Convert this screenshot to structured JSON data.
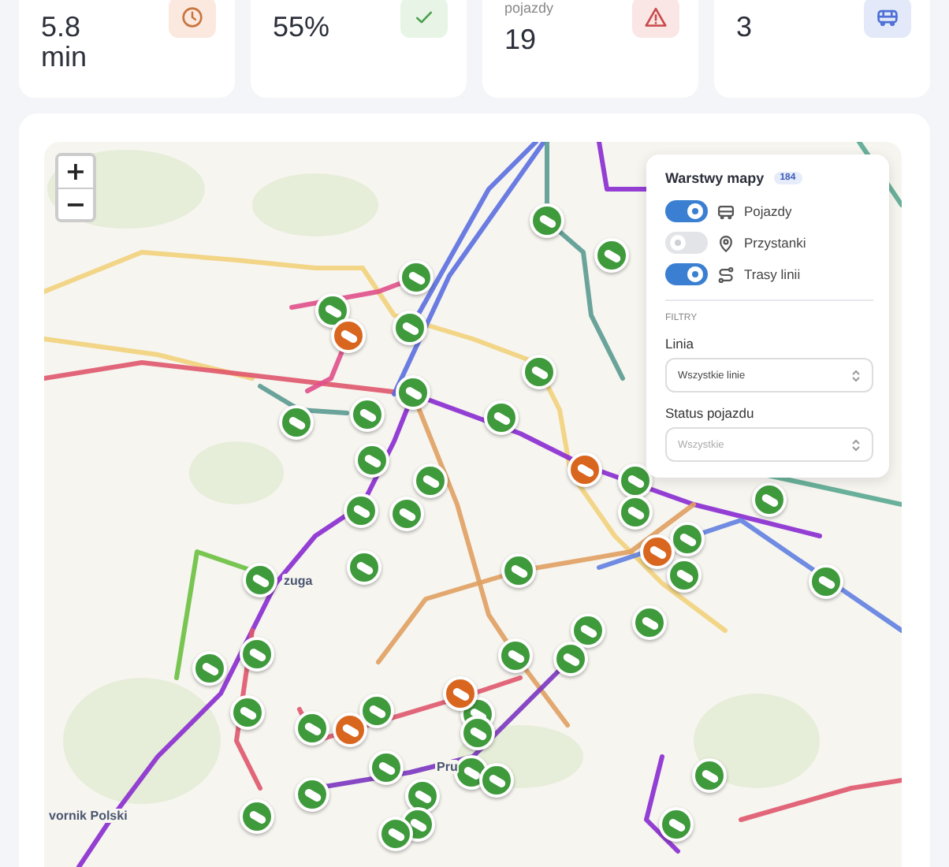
{
  "stats": [
    {
      "value": "5.8 min",
      "kind": "clock"
    },
    {
      "value": "55%",
      "kind": "check"
    },
    {
      "label": "pojazdy",
      "value": "19",
      "kind": "warning"
    },
    {
      "value": "3",
      "kind": "bus"
    }
  ],
  "map": {
    "zoom_in": "+",
    "zoom_out": "−",
    "labels": [
      "zuga",
      "vornik Polski",
      "Pru"
    ],
    "vehicles": [
      {
        "delayed": false
      },
      {
        "delayed": false
      },
      {
        "delayed": false
      },
      {
        "delayed": false
      },
      {
        "delayed": false
      },
      {
        "delayed": false
      },
      {
        "delayed": false
      },
      {
        "delayed": false
      },
      {
        "delayed": false
      },
      {
        "delayed": false
      },
      {
        "delayed": false
      },
      {
        "delayed": false
      },
      {
        "delayed": false
      },
      {
        "delayed": false
      },
      {
        "delayed": false
      },
      {
        "delayed": false
      },
      {
        "delayed": false
      },
      {
        "delayed": false
      },
      {
        "delayed": false
      },
      {
        "delayed": false
      },
      {
        "delayed": false
      },
      {
        "delayed": false
      },
      {
        "delayed": false
      },
      {
        "delayed": false
      },
      {
        "delayed": false
      },
      {
        "delayed": false
      },
      {
        "delayed": false
      },
      {
        "delayed": false
      },
      {
        "delayed": false
      },
      {
        "delayed": false
      },
      {
        "delayed": false
      },
      {
        "delayed": false
      },
      {
        "delayed": false
      },
      {
        "delayed": false
      },
      {
        "delayed": false
      },
      {
        "delayed": false
      },
      {
        "delayed": false
      },
      {
        "delayed": false
      },
      {
        "delayed": false
      },
      {
        "delayed": false
      },
      {
        "delayed": false
      },
      {
        "delayed": false
      },
      {
        "delayed": false
      },
      {
        "delayed": false
      },
      {
        "delayed": true
      },
      {
        "delayed": true
      },
      {
        "delayed": true
      },
      {
        "delayed": true
      },
      {
        "delayed": true
      }
    ]
  },
  "layers_panel": {
    "title": "Warstwy mapy",
    "count": "184",
    "layers": [
      {
        "label": "Pojazdy",
        "kind": "bus",
        "on": true
      },
      {
        "label": "Przystanki",
        "kind": "pin",
        "on": false
      },
      {
        "label": "Trasy linii",
        "kind": "route",
        "on": true
      }
    ],
    "filters_heading": "FILTRY",
    "filters": [
      {
        "label": "Linia",
        "value": "Wszystkie linie"
      },
      {
        "label": "Status pojazdu",
        "placeholder": "Wszystkie"
      }
    ]
  }
}
